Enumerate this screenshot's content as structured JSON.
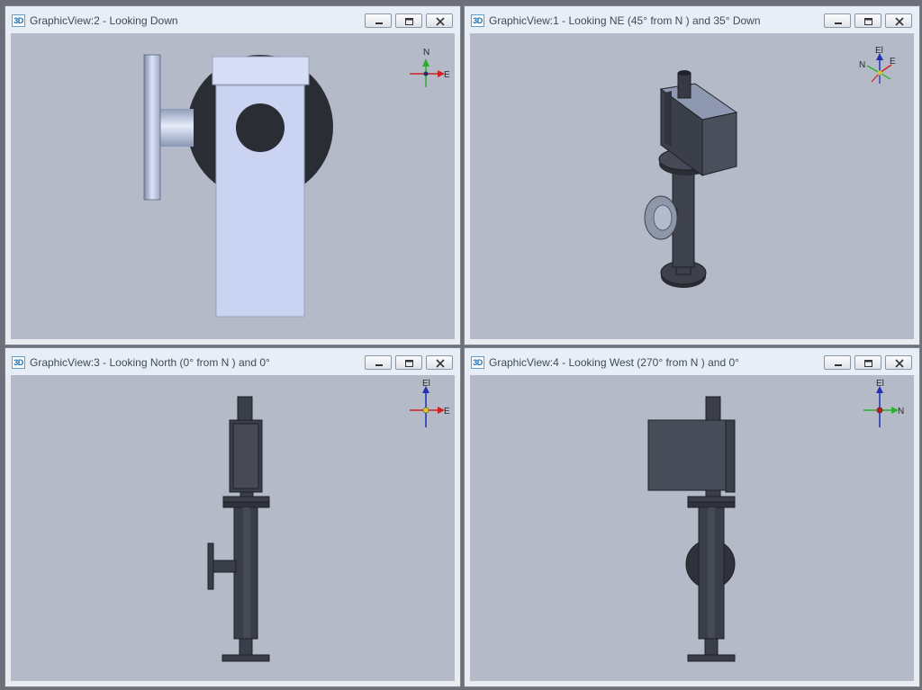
{
  "windows": [
    {
      "id": "v2",
      "title": "GraphicView:2 - Looking Down",
      "icon": "3D",
      "triad": {
        "up": "N",
        "right": "E"
      }
    },
    {
      "id": "v1",
      "title": "GraphicView:1 - Looking NE (45° from N ) and 35° Down",
      "icon": "3D",
      "triad": {
        "up": "El",
        "left": "N",
        "right": "E"
      }
    },
    {
      "id": "v3",
      "title": "GraphicView:3 - Looking North (0° from N ) and 0°",
      "icon": "3D",
      "triad": {
        "up": "El",
        "right": "E"
      }
    },
    {
      "id": "v4",
      "title": "GraphicView:4 - Looking West (270° from N ) and 0°",
      "icon": "3D",
      "triad": {
        "up": "El",
        "right": "N"
      }
    }
  ],
  "colors": {
    "viewport_bg": "#b4bac7",
    "part_dark": "#3a3e48",
    "part_light": "#c9d3f0"
  },
  "icons": {
    "minimize": "minimize-icon",
    "restore": "restore-icon",
    "close": "close-icon"
  }
}
